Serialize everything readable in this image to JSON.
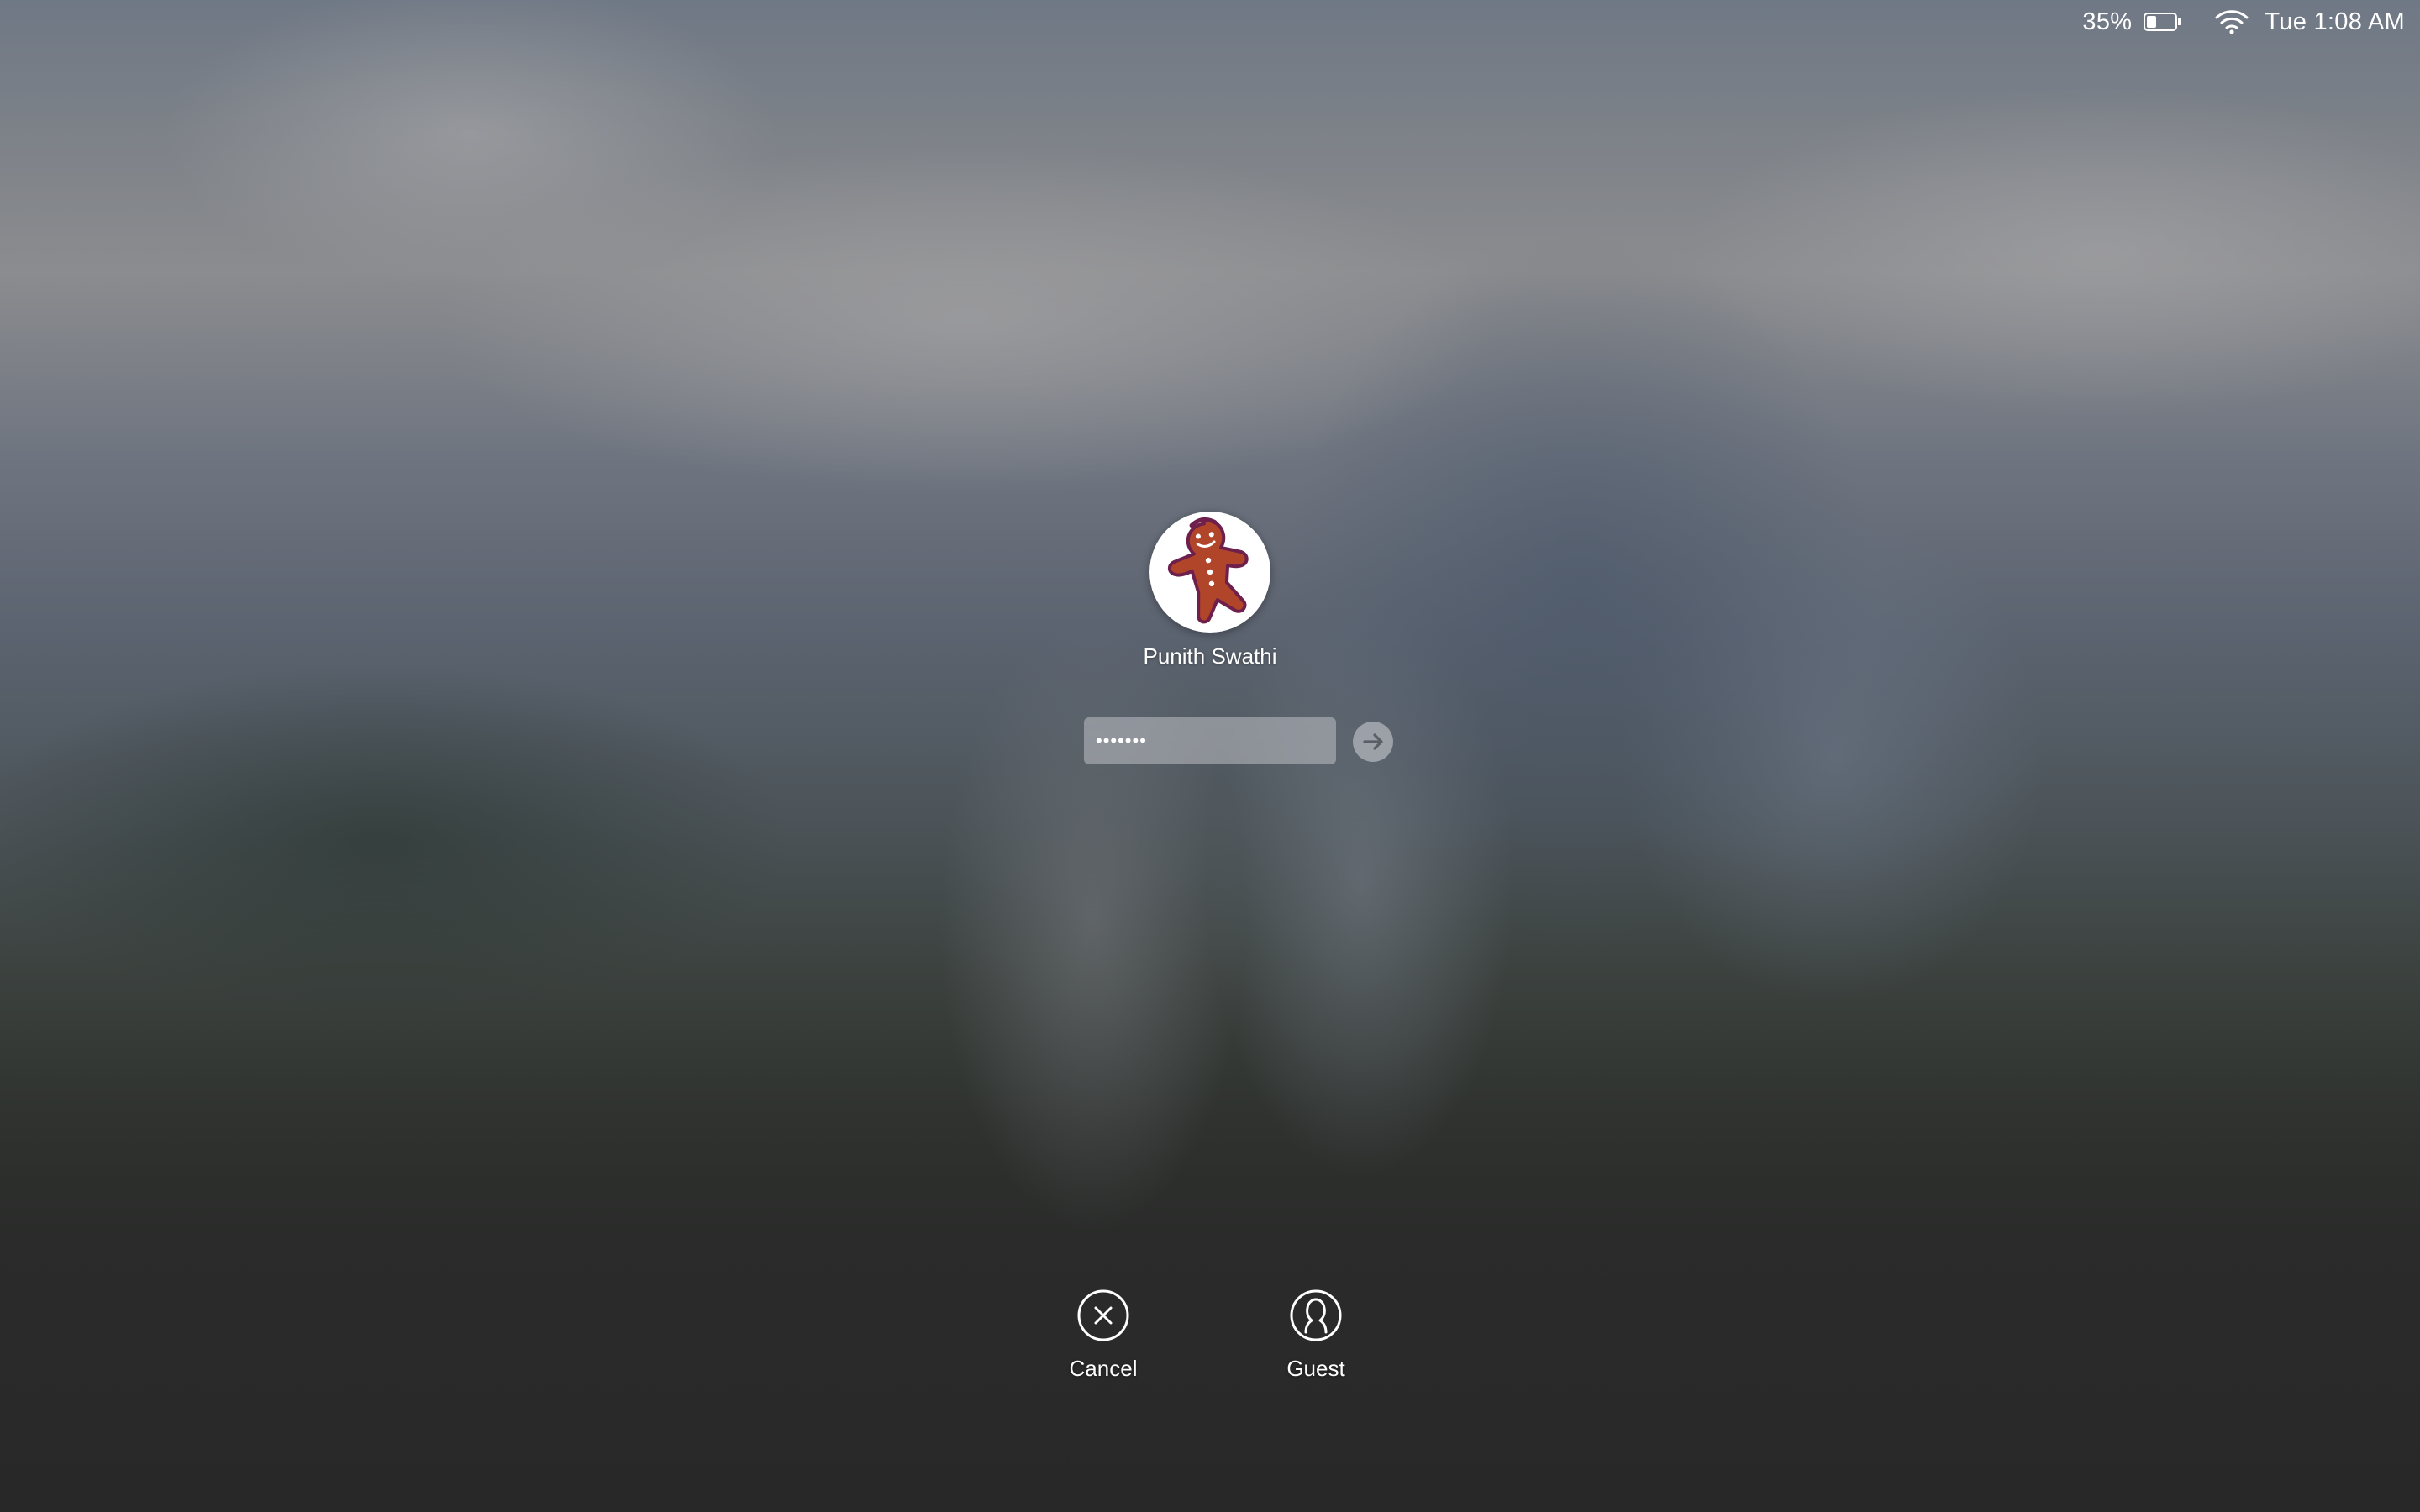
{
  "status_bar": {
    "battery_percent_text": "35%",
    "battery_level": 0.35,
    "battery_icon": "battery-icon",
    "wifi_icon": "wifi-icon",
    "clock": "Tue 1:08 AM"
  },
  "login": {
    "avatar_icon": "gingerbread-man-avatar",
    "user_name": "Punith Swathi",
    "password_value": "•••••••",
    "submit_icon": "arrow-right-icon"
  },
  "actions": {
    "cancel": {
      "label": "Cancel",
      "icon": "cancel-x-circle-icon"
    },
    "guest": {
      "label": "Guest",
      "icon": "guest-user-icon"
    }
  },
  "colors": {
    "text": "#ffffff",
    "dock_background": "#282828",
    "gingerbread": "#b0452a"
  }
}
